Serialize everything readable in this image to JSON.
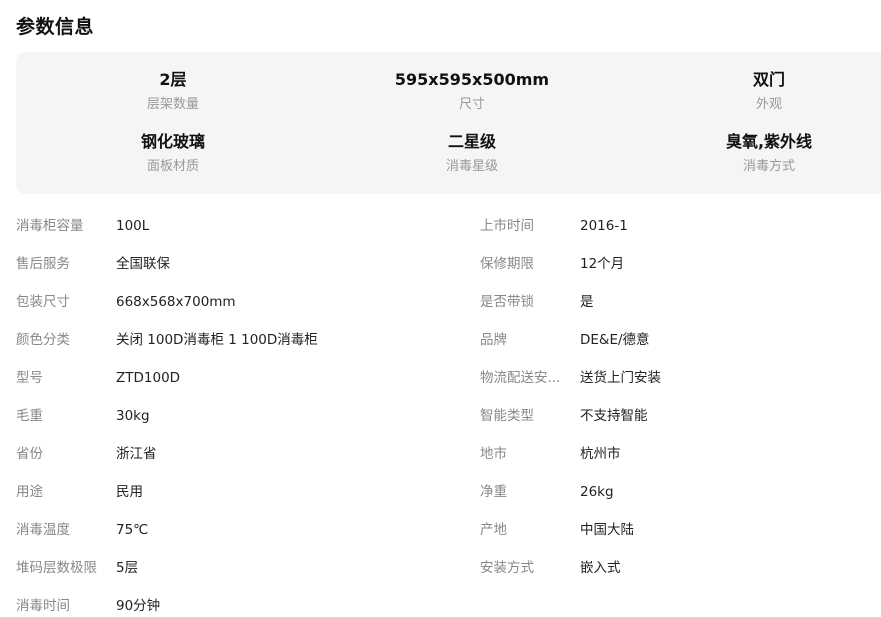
{
  "section": {
    "title": "参数信息"
  },
  "summary": [
    {
      "value": "2层",
      "label": "层架数量"
    },
    {
      "value": "595x595x500mm",
      "label": "尺寸"
    },
    {
      "value": "双门",
      "label": "外观"
    },
    {
      "value": "钢化玻璃",
      "label": "面板材质"
    },
    {
      "value": "二星级",
      "label": "消毒星级"
    },
    {
      "value": "臭氧,紫外线",
      "label": "消毒方式"
    }
  ],
  "specs": {
    "left": [
      {
        "key": "消毒柜容量",
        "value": "100L"
      },
      {
        "key": "售后服务",
        "value": "全国联保"
      },
      {
        "key": "包装尺寸",
        "value": "668x568x700mm"
      },
      {
        "key": "颜色分类",
        "value": "关闭 100D消毒柜 1 100D消毒柜"
      },
      {
        "key": "型号",
        "value": "ZTD100D"
      },
      {
        "key": "毛重",
        "value": "30kg"
      },
      {
        "key": "省份",
        "value": "浙江省"
      },
      {
        "key": "用途",
        "value": "民用"
      },
      {
        "key": "消毒温度",
        "value": "75℃"
      },
      {
        "key": "堆码层数极限",
        "value": "5层"
      },
      {
        "key": "消毒时间",
        "value": "90分钟"
      }
    ],
    "right": [
      {
        "key": "上市时间",
        "value": "2016-1"
      },
      {
        "key": "保修期限",
        "value": "12个月"
      },
      {
        "key": "是否带锁",
        "value": "是"
      },
      {
        "key": "品牌",
        "value": "DE&E/德意"
      },
      {
        "key": "物流配送安...",
        "value": "送货上门安装"
      },
      {
        "key": "智能类型",
        "value": "不支持智能"
      },
      {
        "key": "地市",
        "value": "杭州市"
      },
      {
        "key": "净重",
        "value": "26kg"
      },
      {
        "key": "产地",
        "value": "中国大陆"
      },
      {
        "key": "安装方式",
        "value": "嵌入式"
      }
    ]
  }
}
